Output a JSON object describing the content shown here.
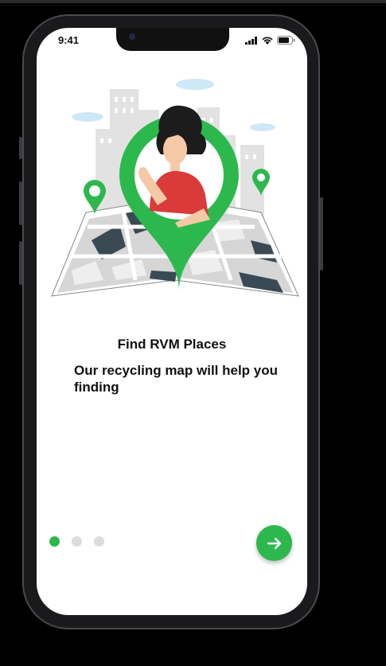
{
  "status_bar": {
    "time": "9:41"
  },
  "onboarding": {
    "title": "Find RVM Places",
    "subtitle": "Our recycling map will help you finding",
    "page_indicator": {
      "total": 3,
      "current": 1
    },
    "next_button_icon": "arrow-right-icon"
  },
  "colors": {
    "accent": "#2db84d",
    "map_dark": "#3a4a55",
    "shirt": "#d93a3a"
  }
}
